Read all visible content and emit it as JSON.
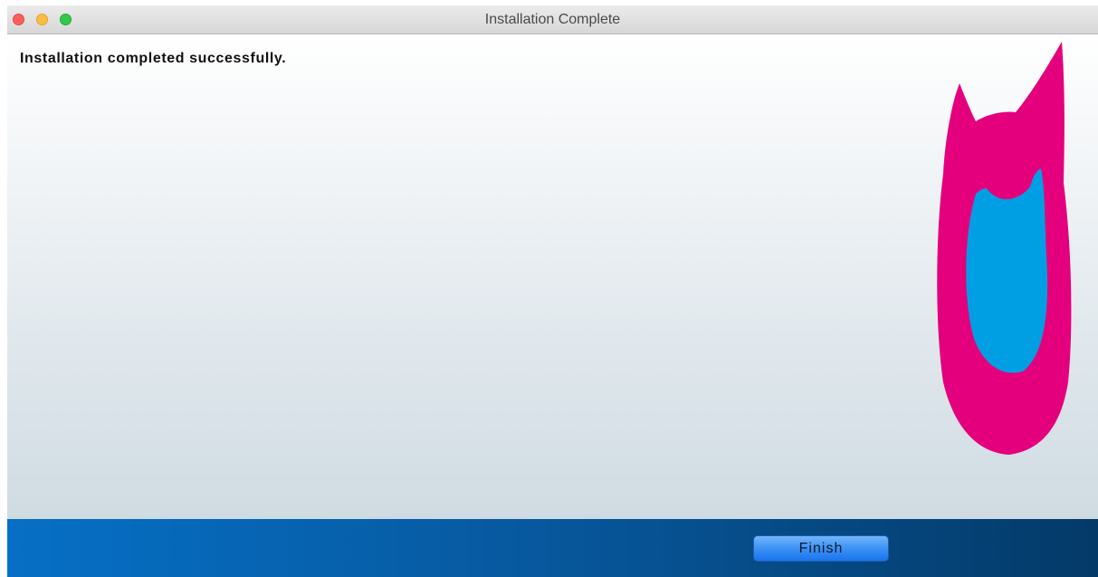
{
  "window": {
    "title": "Installation Complete"
  },
  "content": {
    "message": "Installation completed successfully."
  },
  "footer": {
    "finish_label": "Finish"
  },
  "colors": {
    "logo_outer": "#e4007c",
    "logo_inner": "#009fe3",
    "footer_start": "#0670c6",
    "footer_end": "#043a68"
  }
}
